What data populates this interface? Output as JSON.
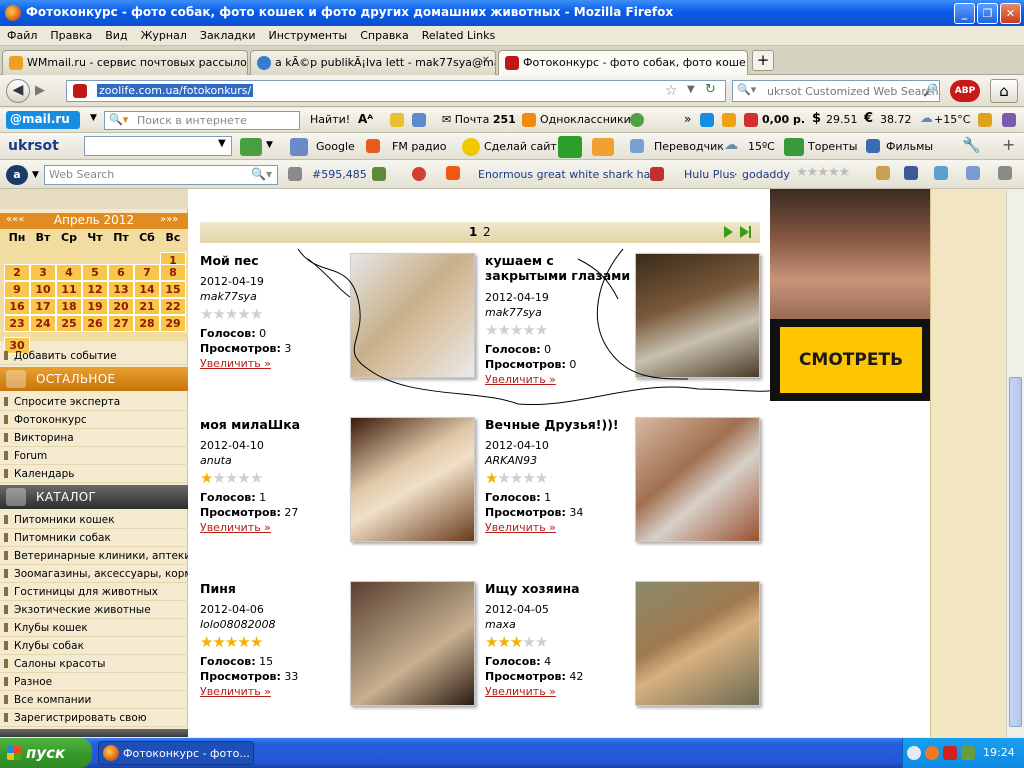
{
  "window": {
    "title": "Фотоконкурс - фото собак, фото кошек и фото других домашних животных - Mozilla Firefox"
  },
  "menu": [
    "Файл",
    "Правка",
    "Вид",
    "Журнал",
    "Закладки",
    "Инструменты",
    "Справка",
    "Related Links"
  ],
  "tabs": [
    {
      "label": "WMmail.ru - сервис почтовых рассылок...",
      "active": false
    },
    {
      "label": "a kÃ©p publikÃ¡lva lett - mak77sya@mail...",
      "active": false
    },
    {
      "label": "Фотоконкурс - фото собак, фото коше...",
      "active": true
    }
  ],
  "nav": {
    "url": "zoolife.com.ua/fotokonkurs/",
    "search_placeholder": "ukrsot Customized Web Search"
  },
  "toolbar_mail": {
    "search_placeholder": "Поиск в интернете",
    "find_label": "Найти!",
    "mail_label": "Почта",
    "mail_count": "251",
    "ok_label": "Одноклассники",
    "balance": "0,00 р.",
    "usd": "29.51",
    "eur": "38.72",
    "weather": "+15°C"
  },
  "toolbar_ukrsot": {
    "brand": "ukrsot",
    "google": "Google",
    "fm": "FM радио",
    "make_site": "Сделай сайт",
    "translator": "Переводчик",
    "temp": "15ºC",
    "torrents": "Торенты",
    "films": "Фильмы"
  },
  "toolbar_web": {
    "search_placeholder": "Web Search",
    "rank": "#595,485",
    "news": "Enormous great white shark ha...",
    "hulu": "Hulu Plus",
    "godaddy": "godaddy"
  },
  "calendar": {
    "month": "Апрель 2012",
    "prev": "«««",
    "next": "»»»",
    "weekdays": [
      "Пн",
      "Вт",
      "Ср",
      "Чт",
      "Пт",
      "Сб",
      "Вс"
    ],
    "weeks": [
      [
        "",
        "",
        "",
        "",
        "",
        "",
        "1"
      ],
      [
        "2",
        "3",
        "4",
        "5",
        "6",
        "7",
        "8"
      ],
      [
        "9",
        "10",
        "11",
        "12",
        "13",
        "14",
        "15"
      ],
      [
        "16",
        "17",
        "18",
        "19",
        "20",
        "21",
        "22"
      ],
      [
        "23",
        "24",
        "25",
        "26",
        "27",
        "28",
        "29"
      ],
      [
        "30",
        "",
        "",
        "",
        "",
        "",
        ""
      ]
    ]
  },
  "sidebar": {
    "add_event": "Добавить событие",
    "section_other": "ОСТАЛЬНОЕ",
    "other_items": [
      "Спросите эксперта",
      "Фотоконкурс",
      "Викторина",
      "Forum",
      "Календарь"
    ],
    "section_catalog": "КАТАЛОГ",
    "catalog_items": [
      "Питомники кошек",
      "Питомники собак",
      "Ветеринарные клиники, аптеки",
      "Зоомагазины, аксессуары, корма",
      "Гостиницы для животных",
      "Экзотические животные",
      "Клубы кошек",
      "Клубы собак",
      "Салоны красоты",
      "Разное",
      "Все компании",
      "Зарегистрировать свою"
    ]
  },
  "pager": {
    "pages": [
      "1",
      "2"
    ],
    "current": "1"
  },
  "photos": [
    {
      "title": "Мой пес",
      "date": "2012-04-19",
      "author": "mak77sya",
      "rating": 0,
      "votes_label": "Голосов:",
      "votes": "0",
      "views_label": "Просмотров:",
      "views": "3",
      "link": "Увеличить »"
    },
    {
      "title": "кушаем с закрытыми глазами",
      "date": "2012-04-19",
      "author": "mak77sya",
      "rating": 0,
      "votes_label": "Голосов:",
      "votes": "0",
      "views_label": "Просмотров:",
      "views": "0",
      "link": "Увеличить »"
    },
    {
      "title": "моя милаШка",
      "date": "2012-04-10",
      "author": "anuta",
      "rating": 1,
      "votes_label": "Голосов:",
      "votes": "1",
      "views_label": "Просмотров:",
      "views": "27",
      "link": "Увеличить »"
    },
    {
      "title": "Вечные Друзья!))!",
      "date": "2012-04-10",
      "author": "ARKAN93",
      "rating": 1,
      "votes_label": "Голосов:",
      "votes": "1",
      "views_label": "Просмотров:",
      "views": "34",
      "link": "Увеличить »"
    },
    {
      "title": "Пиня",
      "date": "2012-04-06",
      "author": "lolo08082008",
      "rating": 5,
      "votes_label": "Голосов:",
      "votes": "15",
      "views_label": "Просмотров:",
      "views": "33",
      "link": "Увеличить »"
    },
    {
      "title": "Ищу хозяина",
      "date": "2012-04-05",
      "author": "maxa",
      "rating": 3,
      "votes_label": "Голосов:",
      "votes": "4",
      "views_label": "Просмотров:",
      "views": "42",
      "link": "Увеличить »"
    }
  ],
  "ad": {
    "button": "СМОТРЕТЬ"
  },
  "taskbar": {
    "start": "пуск",
    "item": "Фотоконкурс - фото...",
    "time": "19:24"
  }
}
